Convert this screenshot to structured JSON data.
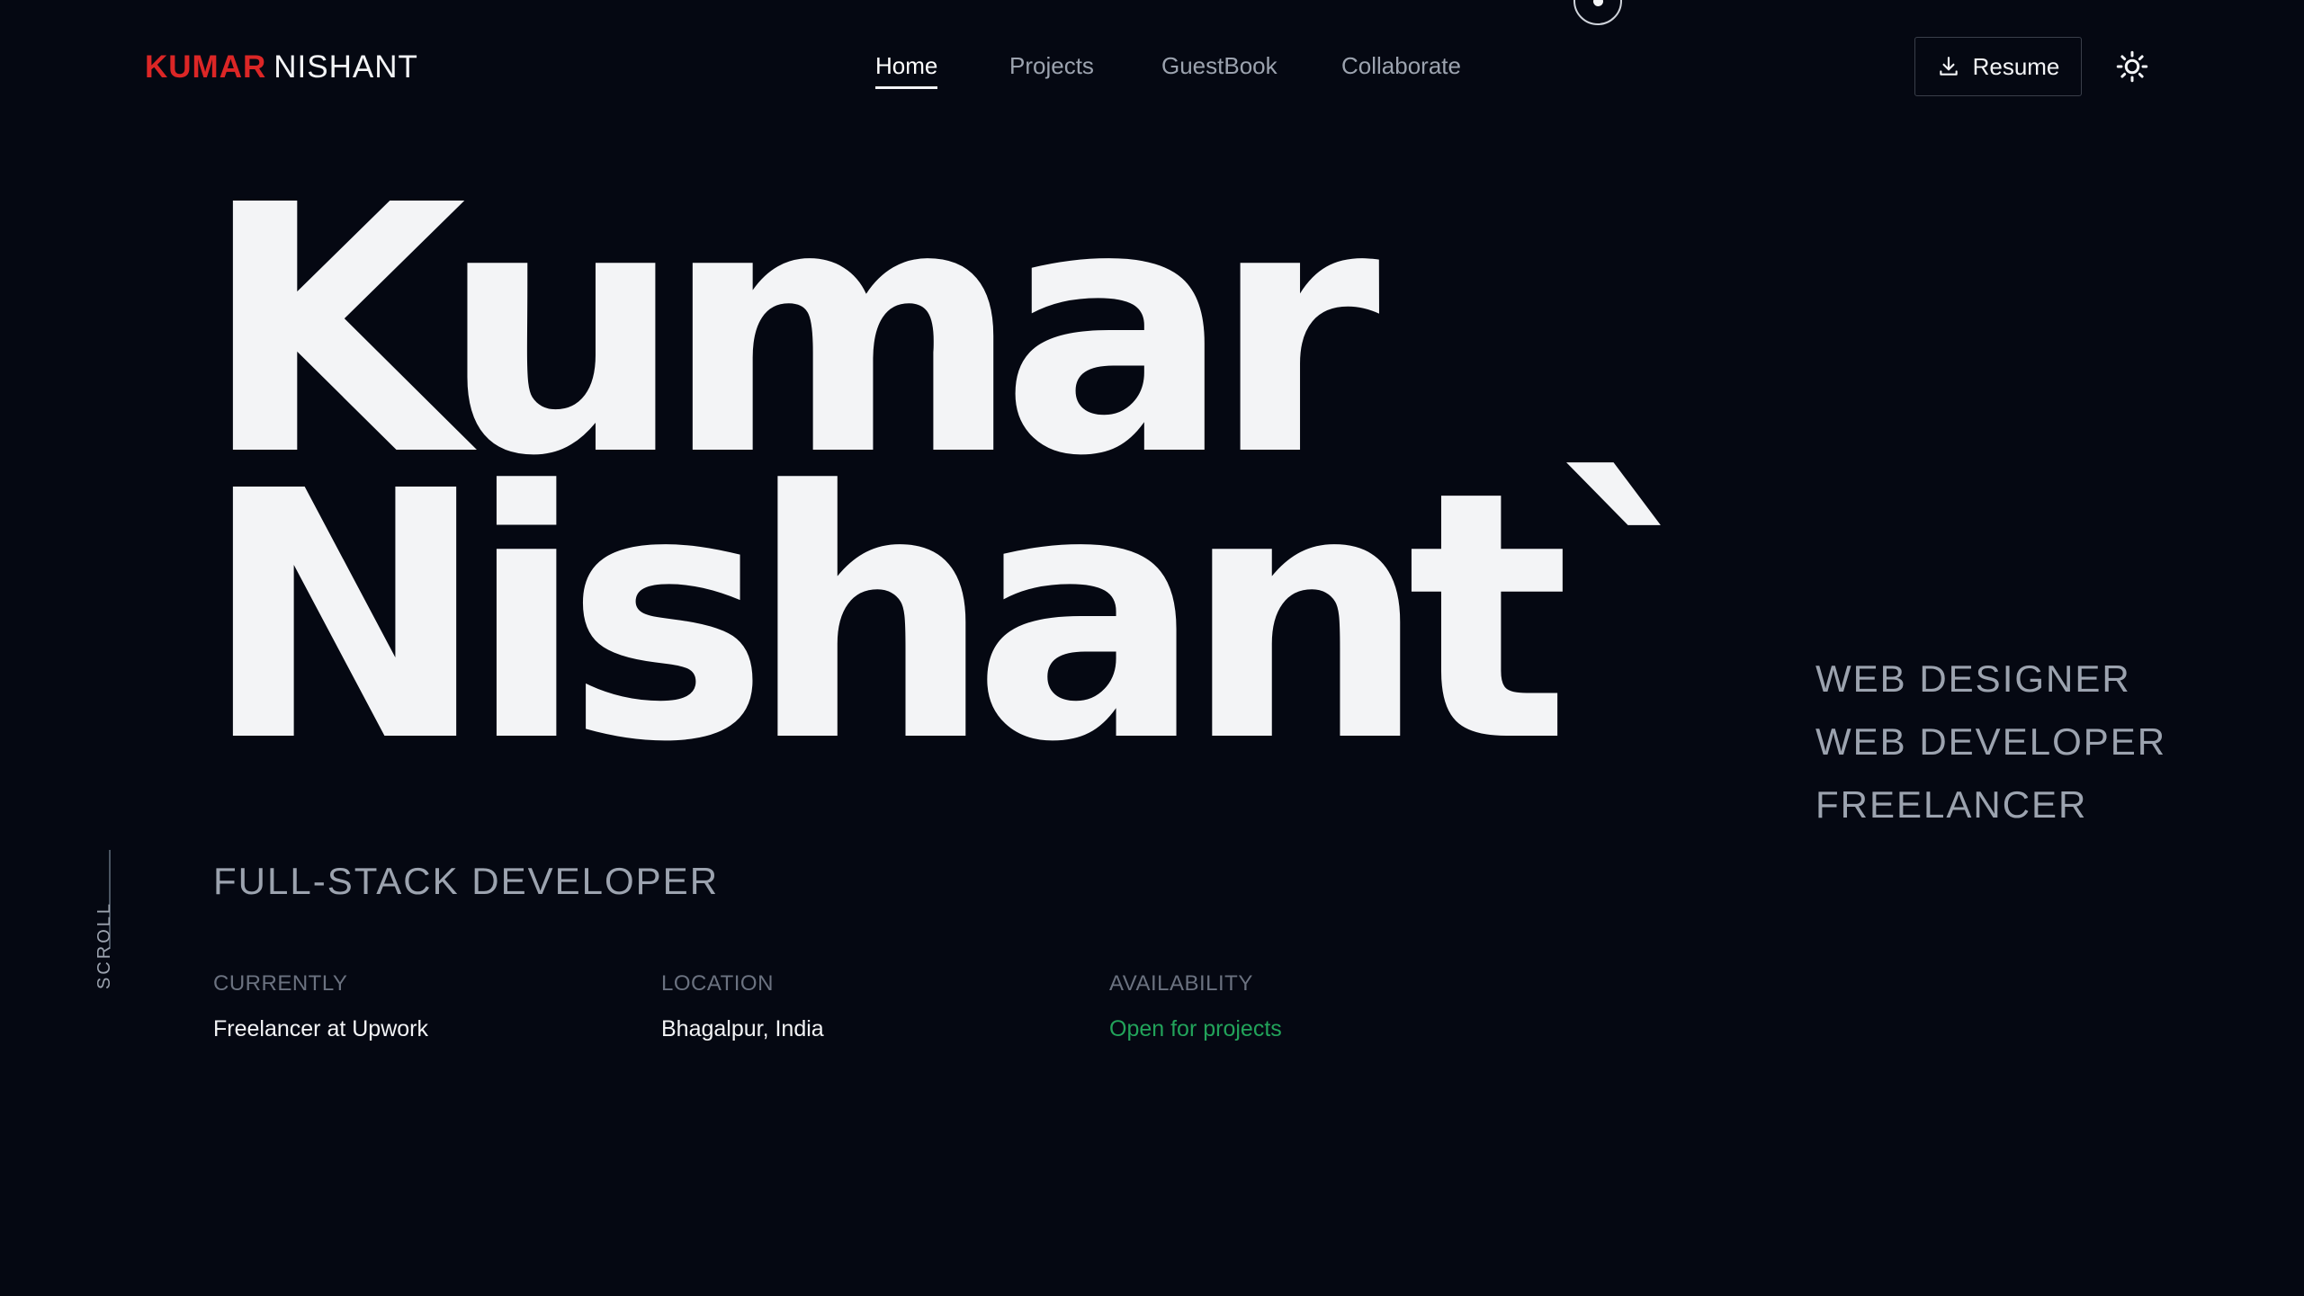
{
  "header": {
    "logo_first": "KUMAR",
    "logo_last": "NISHANT",
    "nav": [
      {
        "label": "Home",
        "active": true
      },
      {
        "label": "Projects",
        "active": false
      },
      {
        "label": "GuestBook",
        "active": false
      },
      {
        "label": "Collaborate",
        "active": false
      }
    ],
    "resume_label": "Resume",
    "resume_icon": "download-icon",
    "theme_icon": "sun-icon"
  },
  "hero": {
    "name_line1": "Kumar",
    "name_line2": "Nishant`",
    "subtitle": "FULL-STACK DEVELOPER"
  },
  "roles": [
    "WEB DESIGNER",
    "WEB DEVELOPER",
    "FREELANCER"
  ],
  "scroll_label": "SCROLL",
  "info": {
    "currently": {
      "label": "CURRENTLY",
      "value": "Freelancer at Upwork"
    },
    "location": {
      "label": "LOCATION",
      "value": "Bhagalpur, India"
    },
    "availability": {
      "label": "AVAILABILITY",
      "value": "Open for projects"
    }
  },
  "colors": {
    "background": "#050812",
    "accent": "#dc2626",
    "available": "#22a35a",
    "muted": "#9ca3af"
  }
}
